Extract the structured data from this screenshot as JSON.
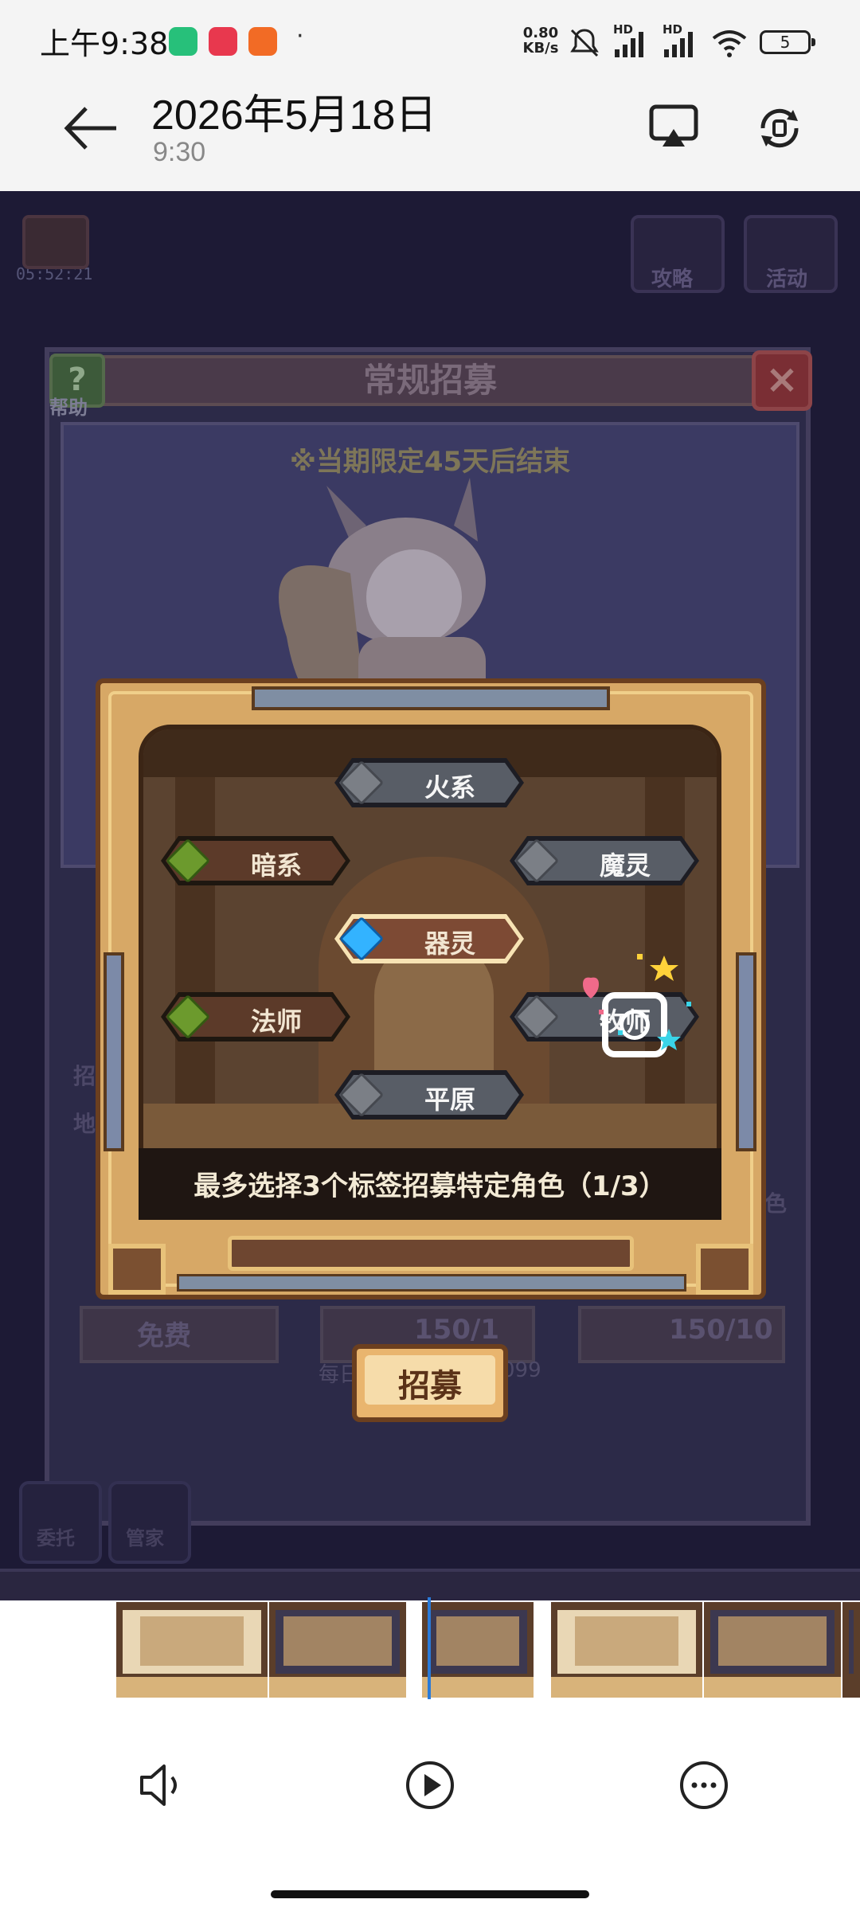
{
  "status_bar": {
    "time": "上午9:38",
    "dot": "·",
    "net_speed_value": "0.80",
    "net_speed_unit": "KB/s",
    "signal_1_label": "HD",
    "signal_2_label": "HD",
    "battery": "5"
  },
  "header": {
    "title": "2026年5月18日",
    "subtitle": "9:30"
  },
  "game": {
    "timer": "05:52:21",
    "top_icons": [
      "攻略",
      "活动"
    ],
    "panel_title": "常规招募",
    "help_label": "帮助",
    "notice": "※当期限定45天后结束",
    "side_labels": [
      "招",
      "地"
    ],
    "bottom_icons": [
      "委托",
      "管家"
    ],
    "cost_texts": [
      "免费",
      "150/1",
      "150/10"
    ],
    "limit_text": "每日",
    "limit_count": "099",
    "right_label": "色"
  },
  "tag_dialog": {
    "tags": {
      "fire": "火系",
      "dark": "暗系",
      "spirit": "魔灵",
      "artifact": "器灵",
      "mage": "法师",
      "priest": "牧师",
      "plains": "平原"
    },
    "prompt": "最多选择3个标签招募特定角色（1/3）",
    "recruit_button": "招募"
  },
  "colors": {
    "game_bg": "#1d1a35",
    "frame_gold": "#d7a866",
    "frame_dark": "#6b3f1f",
    "tag_unselected_plate": "#585d66",
    "tag_brown_plate": "#5c3a29",
    "tag_selected_gem": "#33b3ff",
    "tag_green_gem": "#6c9a2d",
    "playhead": "#2a7ad8"
  },
  "icons": {
    "back": "arrow-left-icon",
    "cast": "screen-cast-icon",
    "rotate": "rotate-icon",
    "volume": "volume-icon",
    "play": "play-icon",
    "more": "more-icon"
  }
}
